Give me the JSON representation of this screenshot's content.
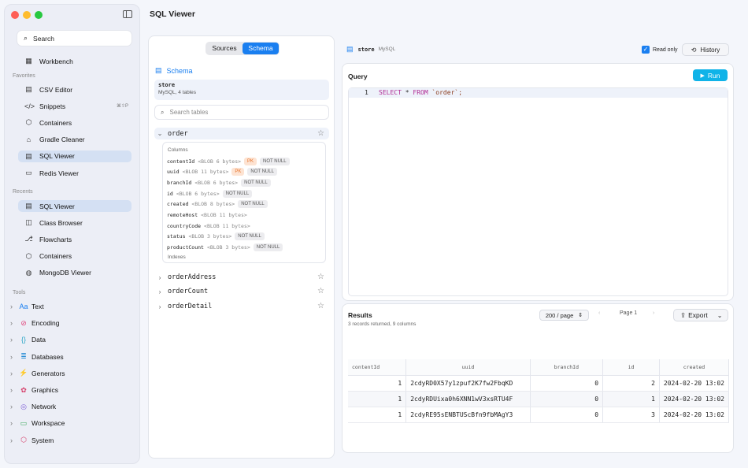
{
  "window_title": "SQL Viewer",
  "sidebar": {
    "search_label": "Search",
    "workbench_label": "Workbench",
    "favorites_header": "Favorites",
    "favorites": [
      {
        "label": "CSV Editor",
        "icon": "table-icon"
      },
      {
        "label": "Snippets",
        "icon": "code-icon",
        "shortcut": "⌘⇧P"
      },
      {
        "label": "Containers",
        "icon": "cube-icon"
      },
      {
        "label": "Gradle Cleaner",
        "icon": "broom-icon"
      },
      {
        "label": "SQL Viewer",
        "icon": "database-table-icon",
        "selected": true
      },
      {
        "label": "Redis Viewer",
        "icon": "redis-icon"
      }
    ],
    "recents_header": "Recents",
    "recents": [
      {
        "label": "SQL Viewer",
        "icon": "database-table-icon",
        "selected": true
      },
      {
        "label": "Class Browser",
        "icon": "layers-icon"
      },
      {
        "label": "Flowcharts",
        "icon": "flowchart-icon"
      },
      {
        "label": "Containers",
        "icon": "cube-icon"
      },
      {
        "label": "MongoDB Viewer",
        "icon": "mongodb-icon"
      }
    ],
    "tools_header": "Tools",
    "tools": [
      {
        "label": "Text",
        "icon": "text-icon",
        "glyph": "Aa",
        "color": "#1a7ff0"
      },
      {
        "label": "Encoding",
        "icon": "encoding-icon",
        "glyph": "⊘",
        "color": "#e0457b"
      },
      {
        "label": "Data",
        "icon": "braces-icon",
        "glyph": "{}",
        "color": "#2fa7c7"
      },
      {
        "label": "Databases",
        "icon": "database-icon",
        "glyph": "≣",
        "color": "#2d8fd5"
      },
      {
        "label": "Generators",
        "icon": "generators-icon",
        "glyph": "⚡",
        "color": "#e8902c"
      },
      {
        "label": "Graphics",
        "icon": "palette-icon",
        "glyph": "✿",
        "color": "#d6406b"
      },
      {
        "label": "Network",
        "icon": "globe-icon",
        "glyph": "◎",
        "color": "#7b5ad6"
      },
      {
        "label": "Workspace",
        "icon": "folder-icon",
        "glyph": "▭",
        "color": "#3aa85a"
      },
      {
        "label": "System",
        "icon": "cube-icon",
        "glyph": "⬡",
        "color": "#d6406b"
      }
    ]
  },
  "left_panel": {
    "segments": [
      "Sources",
      "Schema"
    ],
    "active_segment": "Schema",
    "schema_header": "Schema",
    "store_name": "store",
    "store_desc": "MySQL, 4 tables",
    "table_search_placeholder": "Search tables",
    "tables": [
      "order",
      "orderAddress",
      "orderCount",
      "orderDetail"
    ],
    "expanded_table": "order",
    "columns_label": "Columns",
    "indexes_label": "Indexes",
    "columns": [
      {
        "name": "contentId",
        "type": "<BLOB 6 bytes>",
        "badges": [
          "PK",
          "NOT NULL"
        ]
      },
      {
        "name": "uuid",
        "type": "<BLOB 11 bytes>",
        "badges": [
          "PK",
          "NOT NULL"
        ]
      },
      {
        "name": "branchId",
        "type": "<BLOB 6 bytes>",
        "badges": [
          "NOT NULL"
        ]
      },
      {
        "name": "id",
        "type": "<BLOB 6 bytes>",
        "badges": [
          "NOT NULL"
        ]
      },
      {
        "name": "created",
        "type": "<BLOB 8 bytes>",
        "badges": [
          "NOT NULL"
        ]
      },
      {
        "name": "remoteHost",
        "type": "<BLOB 11 bytes>",
        "badges": []
      },
      {
        "name": "countryCode",
        "type": "<BLOB 11 bytes>",
        "badges": []
      },
      {
        "name": "status",
        "type": "<BLOB 3 bytes>",
        "badges": [
          "NOT NULL"
        ]
      },
      {
        "name": "productCount",
        "type": "<BLOB 3 bytes>",
        "badges": [
          "NOT NULL"
        ]
      }
    ]
  },
  "right_header": {
    "store_name": "store",
    "store_type": "MySQL",
    "read_only_label": "Read only",
    "read_only_checked": true,
    "history_label": "History"
  },
  "query": {
    "title": "Query",
    "run_label": "Run",
    "line_number": "1",
    "sql": "SELECT * FROM `order`;"
  },
  "results": {
    "title": "Results",
    "summary": "3 records returned, 9 columns",
    "page_size": "200 / page",
    "page_label": "Page 1",
    "export_label": "Export",
    "columns": [
      "contentId",
      "uuid",
      "branchId",
      "id",
      "created"
    ],
    "rows": [
      [
        "1",
        "2cdyRD0X57y1zpuf2K7fw2FbqKD",
        "0",
        "2",
        "2024-02-20 13:02"
      ],
      [
        "1",
        "2cdyRDUixa0h6XNN1wV3xsRTU4F",
        "0",
        "1",
        "2024-02-20 13:02"
      ],
      [
        "1",
        "2cdyRE95sENBTUScBfn9fbMAgY3",
        "0",
        "3",
        "2024-02-20 13:02"
      ]
    ]
  },
  "colors": {
    "accent": "#1a7ff0",
    "run_button": "#10b3e8",
    "pk_badge": "#e8742c"
  }
}
